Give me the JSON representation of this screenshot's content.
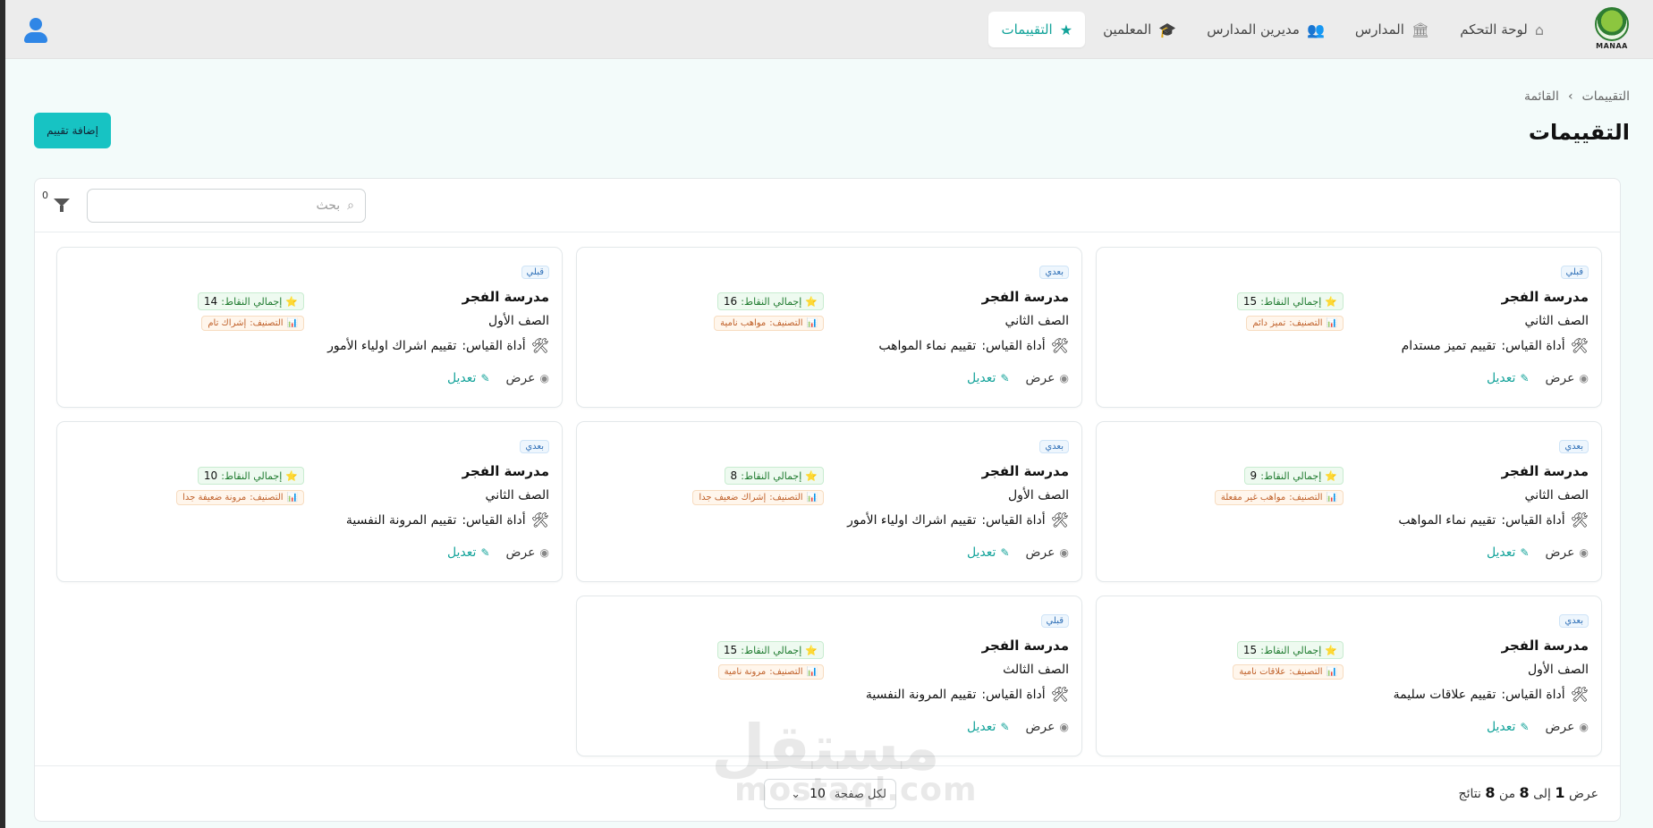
{
  "app": {
    "logo_text": "MANAA"
  },
  "nav": {
    "items": [
      {
        "label": "لوحة التحكم",
        "icon": "home-icon",
        "active": false
      },
      {
        "label": "المدارس",
        "icon": "bank-icon",
        "active": false
      },
      {
        "label": "مديرين المدارس",
        "icon": "users-icon",
        "active": false
      },
      {
        "label": "المعلمين",
        "icon": "graduation-cap-icon",
        "active": false
      },
      {
        "label": "التقييمات",
        "icon": "star-icon",
        "active": true
      }
    ]
  },
  "breadcrumb": [
    "التقييمات",
    "القائمة"
  ],
  "page": {
    "title": "التقييمات",
    "add_button": "إضافة تقييم"
  },
  "search": {
    "placeholder": "بحث"
  },
  "filter": {
    "count": "0"
  },
  "cards": [
    {
      "badge": "قبلي",
      "school": "مدرسة الفجر",
      "grade": "الصف الثاني",
      "tool_label": "أداة القياس:",
      "tool": "تقييم تميز مستدام",
      "points_label": "إجمالي النقاط:",
      "points": "15",
      "class_label": "التصنيف:",
      "class": "تميز دائم",
      "view": "عرض",
      "edit": "تعديل"
    },
    {
      "badge": "بعدي",
      "school": "مدرسة الفجر",
      "grade": "الصف الثاني",
      "tool_label": "أداة القياس:",
      "tool": "تقييم نماء المواهب",
      "points_label": "إجمالي النقاط:",
      "points": "16",
      "class_label": "التصنيف:",
      "class": "مواهب نامية",
      "view": "عرض",
      "edit": "تعديل"
    },
    {
      "badge": "قبلي",
      "school": "مدرسة الفجر",
      "grade": "الصف الأول",
      "tool_label": "أداة القياس:",
      "tool": "تقييم اشراك اولياء الأمور",
      "points_label": "إجمالي النقاط:",
      "points": "14",
      "class_label": "التصنيف:",
      "class": "إشراك تام",
      "view": "عرض",
      "edit": "تعديل"
    },
    {
      "badge": "بعدي",
      "school": "مدرسة الفجر",
      "grade": "الصف الثاني",
      "tool_label": "أداة القياس:",
      "tool": "تقييم نماء المواهب",
      "points_label": "إجمالي النقاط:",
      "points": "9",
      "class_label": "التصنيف:",
      "class": "مواهب غير مفعلة",
      "view": "عرض",
      "edit": "تعديل"
    },
    {
      "badge": "بعدي",
      "school": "مدرسة الفجر",
      "grade": "الصف الأول",
      "tool_label": "أداة القياس:",
      "tool": "تقييم اشراك اولياء الأمور",
      "points_label": "إجمالي النقاط:",
      "points": "8",
      "class_label": "التصنيف:",
      "class": "إشراك ضعيف جدا",
      "view": "عرض",
      "edit": "تعديل"
    },
    {
      "badge": "بعدي",
      "school": "مدرسة الفجر",
      "grade": "الصف الثاني",
      "tool_label": "أداة القياس:",
      "tool": "تقييم المرونة النفسية",
      "points_label": "إجمالي النقاط:",
      "points": "10",
      "class_label": "التصنيف:",
      "class": "مرونة ضعيفة جدا",
      "view": "عرض",
      "edit": "تعديل"
    },
    {
      "badge": "بعدي",
      "school": "مدرسة الفجر",
      "grade": "الصف الأول",
      "tool_label": "أداة القياس:",
      "tool": "تقييم علاقات سليمة",
      "points_label": "إجمالي النقاط:",
      "points": "15",
      "class_label": "التصنيف:",
      "class": "علاقات نامية",
      "view": "عرض",
      "edit": "تعديل"
    },
    {
      "badge": "قبلي",
      "school": "مدرسة الفجر",
      "grade": "الصف الثالث",
      "tool_label": "أداة القياس:",
      "tool": "تقييم المرونة النفسية",
      "points_label": "إجمالي النقاط:",
      "points": "15",
      "class_label": "التصنيف:",
      "class": "مرونة نامية",
      "view": "عرض",
      "edit": "تعديل"
    }
  ],
  "pagination": {
    "per_page_label": "لكل صفحة",
    "per_page_value": "10",
    "summary_prefix": "عرض",
    "from": "1",
    "to_word": "إلى",
    "to": "8",
    "of_word": "من",
    "total": "8",
    "results_word": "نتائج"
  },
  "watermark": {
    "arabic": "مستقل",
    "latin": "mostaql.com"
  }
}
